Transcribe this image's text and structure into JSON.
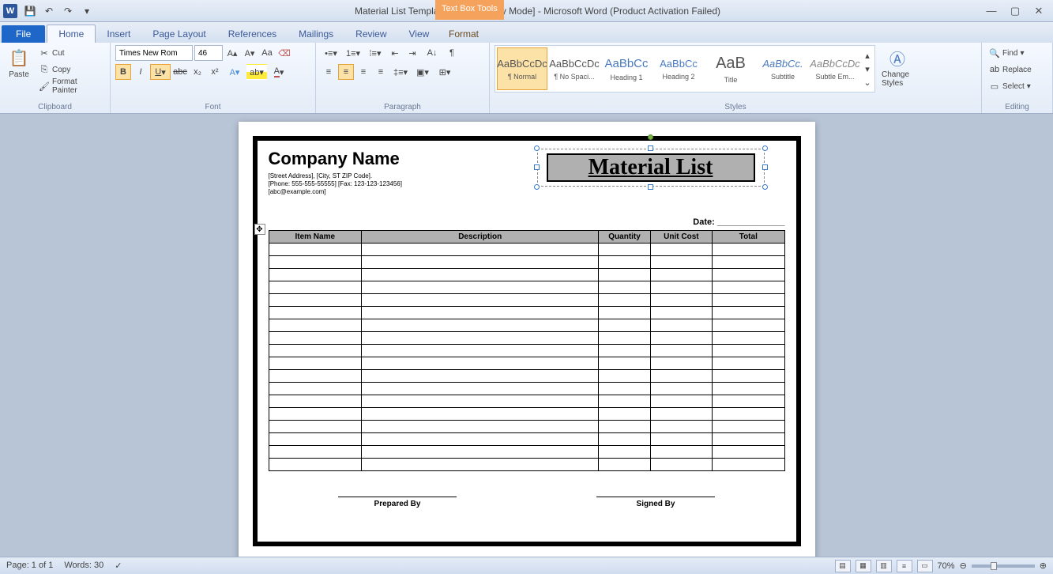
{
  "titlebar": {
    "title": "Material List Template [Compatibility Mode] - Microsoft Word (Product Activation Failed)"
  },
  "contextual": {
    "group_label": "Text Box Tools",
    "tab": "Format"
  },
  "tabs": {
    "file": "File",
    "items": [
      "Home",
      "Insert",
      "Page Layout",
      "References",
      "Mailings",
      "Review",
      "View"
    ],
    "active": "Home"
  },
  "ribbon": {
    "clipboard": {
      "label": "Clipboard",
      "paste": "Paste",
      "cut": "Cut",
      "copy": "Copy",
      "fp": "Format Painter"
    },
    "font": {
      "label": "Font",
      "name": "Times New Rom",
      "size": "46"
    },
    "paragraph": {
      "label": "Paragraph"
    },
    "styles": {
      "label": "Styles",
      "change": "Change Styles",
      "items": [
        {
          "prev": "AaBbCcDc",
          "name": "¶ Normal"
        },
        {
          "prev": "AaBbCcDc",
          "name": "¶ No Spaci..."
        },
        {
          "prev": "AaBbCc",
          "name": "Heading 1"
        },
        {
          "prev": "AaBbCc",
          "name": "Heading 2"
        },
        {
          "prev": "AaB",
          "name": "Title"
        },
        {
          "prev": "AaBbCc.",
          "name": "Subtitle"
        },
        {
          "prev": "AaBbCcDc",
          "name": "Subtle Em..."
        }
      ]
    },
    "editing": {
      "label": "Editing",
      "find": "Find",
      "replace": "Replace",
      "select": "Select"
    }
  },
  "document": {
    "company": {
      "name": "Company Name",
      "addr": "[Street Address], [City, ST ZIP Code].",
      "phone": "[Phone: 555-555-55555] [Fax: 123-123-123456]",
      "email": "[abc@example.com]"
    },
    "title_box": "Material List",
    "date_label": "Date: ______________",
    "columns": [
      "Item Name",
      "Description",
      "Quantity",
      "Unit Cost",
      "Total"
    ],
    "rows": 18,
    "prepared": "Prepared By",
    "signed": "Signed By"
  },
  "status": {
    "page": "Page: 1 of 1",
    "words": "Words: 30",
    "zoom": "70%"
  }
}
